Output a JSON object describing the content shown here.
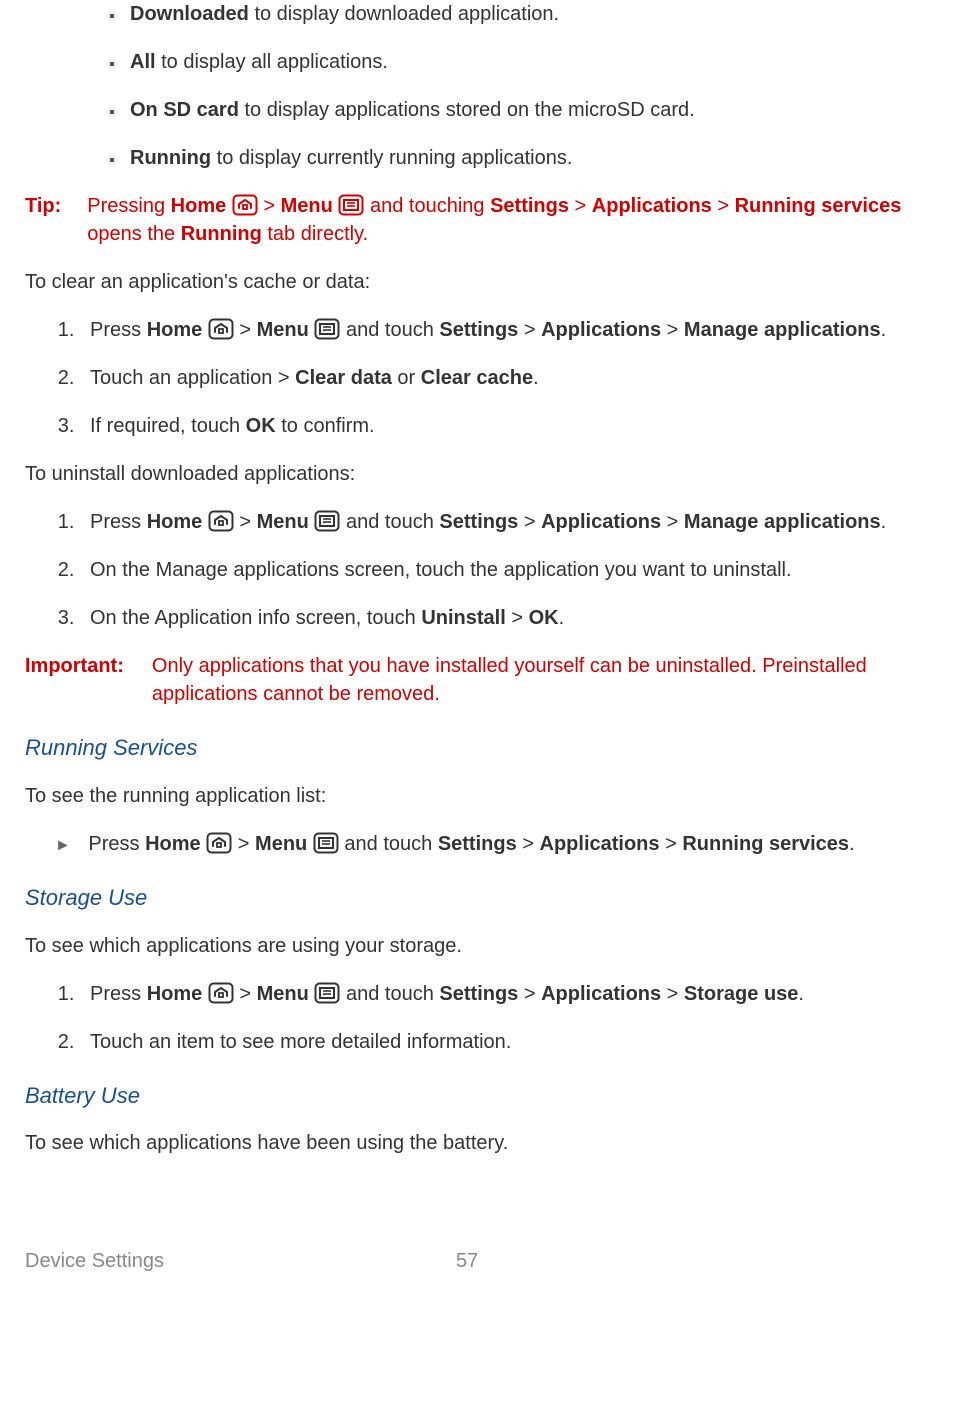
{
  "bullets": {
    "downloaded": {
      "bold": "Downloaded",
      "rest": " to display downloaded application."
    },
    "all": {
      "bold": "All",
      "rest": " to display all applications."
    },
    "sdcard": {
      "bold": "On SD card",
      "rest": " to display applications stored on the microSD card."
    },
    "running": {
      "bold": "Running",
      "rest": " to display currently running applications."
    }
  },
  "tip": {
    "label": "Tip:",
    "p1a": "Pressing ",
    "home": "Home",
    "gt1": " > ",
    "menu": "Menu",
    "p1b": " and touching ",
    "settings": "Settings",
    "gt2": " > ",
    "applications": "Applications",
    "gt3": " > ",
    "runningservices": "Running services",
    "p2a": " opens the ",
    "runningtab": "Running",
    "p2b": " tab directly."
  },
  "clear_intro": "To clear an application's cache or data:",
  "clear_steps": {
    "s1": {
      "a": "Press ",
      "home": "Home",
      "gt1": " > ",
      "menu": "Menu",
      "b": " and touch ",
      "settings": "Settings",
      "gt2": " > ",
      "apps": "Applications",
      "gt3": " > ",
      "manage": "Manage applications",
      "end": "."
    },
    "s2": {
      "a": "Touch an application > ",
      "cd": "Clear data",
      "or": " or ",
      "cc": "Clear cache",
      "end": "."
    },
    "s3": {
      "a": "If required, touch ",
      "ok": "OK",
      "b": " to confirm."
    }
  },
  "uninstall_intro": "To uninstall downloaded applications:",
  "uninstall_steps": {
    "s1": {
      "a": "Press ",
      "home": "Home",
      "gt1": " > ",
      "menu": "Menu",
      "b": " and touch ",
      "settings": "Settings",
      "gt2": " > ",
      "apps": "Applications",
      "gt3": " > ",
      "manage": "Manage applications",
      "end": "."
    },
    "s2": "On the Manage applications screen, touch the application you want to uninstall.",
    "s3": {
      "a": "On the Application info screen, touch ",
      "uninstall": "Uninstall",
      "gt": " > ",
      "ok": "OK",
      "end": "."
    }
  },
  "important": {
    "label": "Important:",
    "text": "Only applications that you have installed yourself can be uninstalled. Preinstalled applications cannot be removed."
  },
  "running_services_heading": "Running Services",
  "running_services_intro": "To see the running application list:",
  "running_services_step": {
    "a": "Press ",
    "home": "Home",
    "gt1": " > ",
    "menu": "Menu",
    "b": " and touch ",
    "settings": "Settings",
    "gt2": " > ",
    "apps": "Applications",
    "gt3": " > ",
    "rs": "Running services",
    "end": "."
  },
  "storage_heading": "Storage Use",
  "storage_intro": "To see which applications are using your storage.",
  "storage_steps": {
    "s1": {
      "a": "Press ",
      "home": "Home",
      "gt1": " > ",
      "menu": "Menu",
      "b": " and touch ",
      "settings": "Settings",
      "gt2": " > ",
      "apps": "Applications",
      "gt3": " > ",
      "su": "Storage use",
      "end": "."
    },
    "s2": "Touch an item to see more detailed information."
  },
  "battery_heading": "Battery Use",
  "battery_intro": "To see which applications have been using the battery.",
  "footer": {
    "section": "Device Settings",
    "page": "57"
  }
}
